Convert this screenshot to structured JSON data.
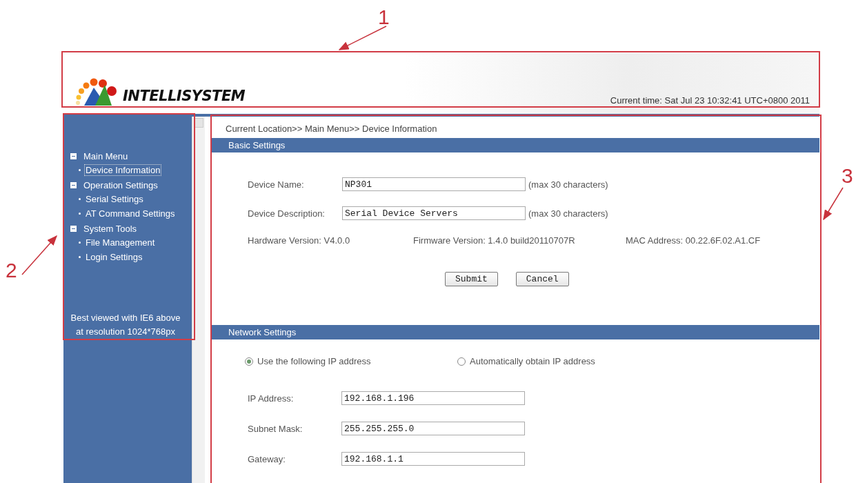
{
  "header": {
    "logo": "INTELLISYSTEM",
    "current_time": "Current time: Sat Jul 23 10:32:41 UTC+0800 2011"
  },
  "sidebar": {
    "items": [
      {
        "label": "Main Menu",
        "expanded": true,
        "children": [
          {
            "label": "Device Information",
            "selected": true
          }
        ]
      },
      {
        "label": "Operation Settings",
        "expanded": true,
        "children": [
          {
            "label": "Serial Settings",
            "selected": false
          },
          {
            "label": "AT Command Settings",
            "selected": false
          }
        ]
      },
      {
        "label": "System Tools",
        "expanded": true,
        "children": [
          {
            "label": "File Management",
            "selected": false
          },
          {
            "label": "Login Settings",
            "selected": false
          }
        ]
      }
    ],
    "note": "Best viewed with IE6 above at resolution 1024*768px"
  },
  "breadcrumb": "Current Location>> Main Menu>> Device Information",
  "basic_settings": {
    "title": "Basic Settings",
    "fields": [
      {
        "label": "Device Name:",
        "value": "NP301",
        "hint": "(max 30 characters)"
      },
      {
        "label": "Device Description:",
        "value": "Serial Device Servers",
        "hint": "(max 30 characters)"
      }
    ],
    "info": [
      "Hardware Version: V4.0.0",
      "Firmware Version: 1.4.0 build20110707R",
      "MAC Address: 00.22.6F.02.A1.CF"
    ],
    "buttons": [
      "Submit",
      "Cancel"
    ]
  },
  "network_settings": {
    "title": "Network Settings",
    "modes": [
      {
        "label": "Use the following IP address",
        "selected": true
      },
      {
        "label": "Automatically obtain IP address",
        "selected": false
      }
    ],
    "fields": [
      {
        "label": "IP Address:",
        "value": "192.168.1.196"
      },
      {
        "label": "Subnet Mask:",
        "value": "255.255.255.0"
      },
      {
        "label": "Gateway:",
        "value": "192.168.1.1"
      }
    ]
  },
  "annotations": [
    {
      "label": "1"
    },
    {
      "label": "2"
    },
    {
      "label": "3"
    }
  ]
}
